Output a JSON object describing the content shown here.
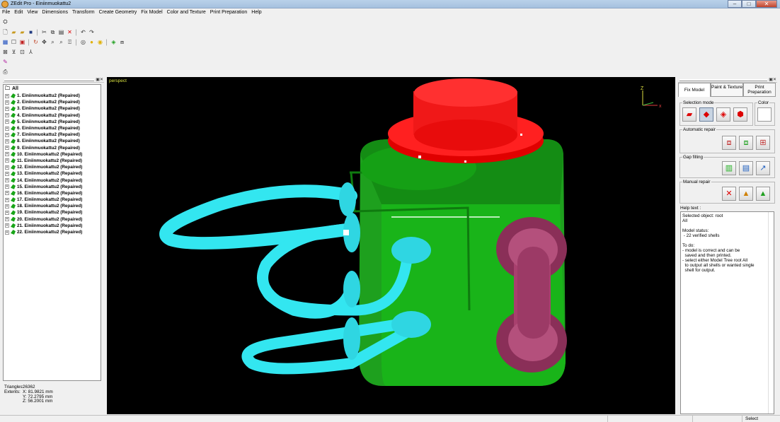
{
  "window": {
    "title": "ZEdit Pro - Einiinmuokattu2",
    "controls": [
      "–",
      "□",
      "✕"
    ]
  },
  "menu": [
    "File",
    "Edit",
    "View",
    "Dimensions",
    "Transform",
    "Create Geometry",
    "Fix Model",
    "Color and Texture",
    "Print Preparation",
    "Help"
  ],
  "toolbar": {
    "row1": [
      "app-icon"
    ],
    "row2": [
      "new-icon",
      "open-icon",
      "open-folder-icon",
      "save-icon",
      "cut-icon",
      "copy-icon",
      "paste-icon",
      "delete-icon",
      "undo-icon",
      "redo-icon"
    ],
    "row3": [
      "grid-icon",
      "select-box-icon",
      "color-select-icon",
      "rotate-icon",
      "pan-icon",
      "zoom-icon",
      "zoom-fit-icon",
      "zoom-region-icon",
      "view-front-icon",
      "light-icon",
      "light2-icon",
      "paint-icon",
      "cube-icon"
    ],
    "row4": [
      "axis-x-icon",
      "axis-y-icon",
      "axis-z-icon",
      "axes-icon"
    ],
    "row5": [
      "pencil-icon"
    ],
    "row6": [
      "print-icon"
    ]
  },
  "tree": {
    "root": "All",
    "items": [
      "1. Einiinmuokattu2 (Repaired)",
      "2. Einiinmuokattu2 (Repaired)",
      "3. Einiinmuokattu2 (Repaired)",
      "4. Einiinmuokattu2 (Repaired)",
      "5. Einiinmuokattu2 (Repaired)",
      "6. Einiinmuokattu2 (Repaired)",
      "7. Einiinmuokattu2 (Repaired)",
      "8. Einiinmuokattu2 (Repaired)",
      "9. Einiinmuokattu2 (Repaired)",
      "10. Einiinmuokattu2 (Repaired)",
      "11. Einiinmuokattu2 (Repaired)",
      "12. Einiinmuokattu2 (Repaired)",
      "13. Einiinmuokattu2 (Repaired)",
      "14. Einiinmuokattu2 (Repaired)",
      "15. Einiinmuokattu2 (Repaired)",
      "16. Einiinmuokattu2 (Repaired)",
      "17. Einiinmuokattu2 (Repaired)",
      "18. Einiinmuokattu2 (Repaired)",
      "19. Einiinmuokattu2 (Repaired)",
      "20. Einiinmuokattu2 (Repaired)",
      "21. Einiinmuokattu2 (Repaired)",
      "22. Einiinmuokattu2 (Repaired)"
    ]
  },
  "stats": {
    "triangles_label": "Triangles:",
    "triangles": "26362",
    "extents_label": "Extents:",
    "x": "X: 81.9821 mm",
    "y": "Y: 72.2795 mm",
    "z": "Z: 56.2001 mm"
  },
  "viewport": {
    "label": "perspect",
    "axis_x": "x",
    "axis_z": "Z"
  },
  "panel": {
    "tabs": [
      "Fix Model",
      "Paint & Texture",
      "Print Preparation"
    ],
    "selection_mode": "Selection mode",
    "color": "Color",
    "automatic_repair": "Automatic repair",
    "gap_filling": "Gap filling",
    "manual_repair": "Manual repair",
    "help_label": "Help text :",
    "help_text": "Selected object: root\nAll\n\nModel status:\n - 22 verified shells\n\nTo do:\n- model is correct and can be\n  saved and then printed.\n- select either Model Tree root All\n  to output all shells or wanted single\n  shell for output."
  },
  "status": {
    "right": "Select"
  },
  "colors": {
    "red": "#ff1a1a",
    "green": "#1fa51f",
    "cyan": "#33e6f0",
    "magenta": "#a8406e",
    "background": "#000000"
  }
}
